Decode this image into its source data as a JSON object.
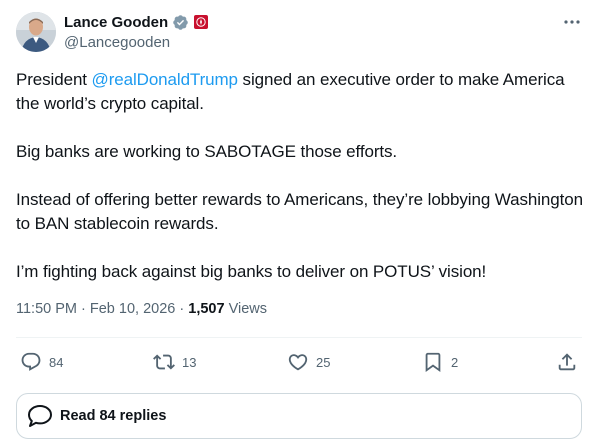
{
  "author": {
    "display_name": "Lance Gooden",
    "handle": "@Lancegooden",
    "verified": true,
    "badge_icon": "affiliation-seal-icon"
  },
  "tweet": {
    "intro_before": "President ",
    "mention": "@realDonaldTrump",
    "intro_after": " signed an executive order to make America the world’s crypto capital.",
    "paragraph_2": "Big banks are working to SABOTAGE those efforts.",
    "paragraph_3": "Instead of offering better rewards to Americans, they’re lobbying Washington to BAN stablecoin rewards.",
    "paragraph_4": "I’m fighting back against big banks to deliver on POTUS’ vision!"
  },
  "meta": {
    "time": "11:50 PM",
    "separator": " · ",
    "date": "Feb 10, 2026",
    "views_count": "1,507",
    "views_label": "Views"
  },
  "actions": {
    "replies": "84",
    "reposts": "13",
    "likes": "25",
    "bookmarks": "2"
  },
  "read_replies": {
    "label": "Read 84 replies"
  },
  "colors": {
    "text": "#0f1419",
    "secondary": "#536471",
    "link": "#1d9bf0",
    "verified": "#829aab",
    "border": "#cfd9de"
  }
}
